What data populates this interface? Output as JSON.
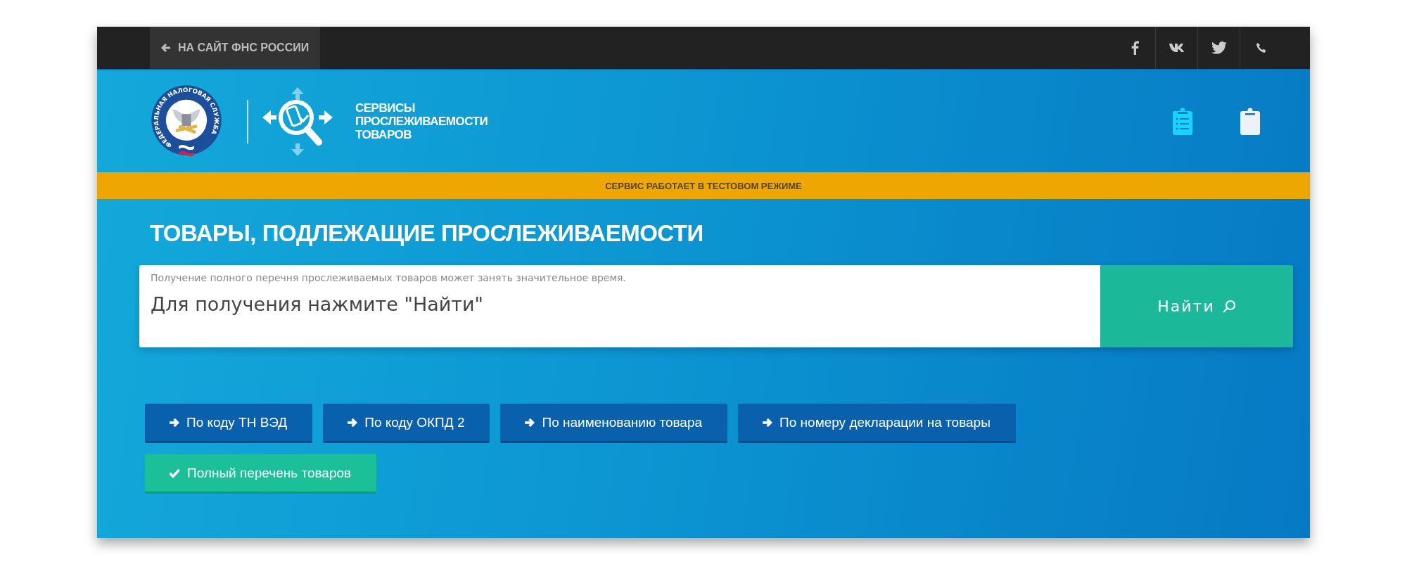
{
  "top_bar": {
    "back_link": "НА САЙТ ФНС РОССИИ"
  },
  "header": {
    "emblem_text": "ФЕДЕРАЛЬНАЯ НАЛОГОВАЯ СЛУЖБА",
    "service_name": [
      "СЕРВИСЫ",
      "ПРОСЛЕЖИВАЕМОСТИ",
      "ТОВАРОВ"
    ]
  },
  "notice": "СЕРВИС РАБОТАЕТ В ТЕСТОВОМ РЕЖИМЕ",
  "title": "ТОВАРЫ, ПОДЛЕЖАЩИЕ ПРОСЛЕЖИВАЕМОСТИ",
  "search": {
    "hint": "Получение полного перечня прослеживаемых товаров может занять значительное время.",
    "value": "Для получения нажмите \"Найти\"",
    "button": "Найти"
  },
  "modes": [
    {
      "label": "По коду ТН ВЭД",
      "selected": false
    },
    {
      "label": "По коду ОКПД 2",
      "selected": false
    },
    {
      "label": "По наименованию товара",
      "selected": false
    },
    {
      "label": "По номеру декларации на товары",
      "selected": false
    },
    {
      "label": "Полный перечень товаров",
      "selected": true
    }
  ]
}
